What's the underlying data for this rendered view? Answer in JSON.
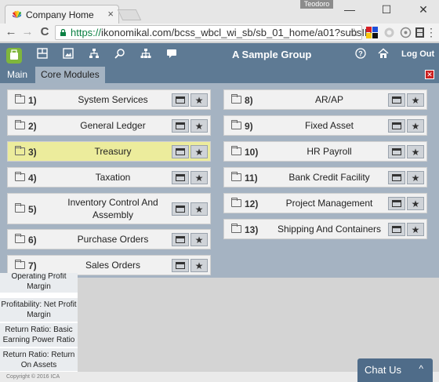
{
  "browser": {
    "tab_title": "Company Home",
    "user_badge": "Teodoro",
    "url_scheme": "https://",
    "url_rest": "ikonomikal.com/bcss_wbcl_wi_sb/sb_01_home/a01?subsID=",
    "window_minimize": "—",
    "window_maximize": "☐",
    "window_close": "✕",
    "back_glyph": "←",
    "forward_glyph": "→",
    "reload_glyph": "C"
  },
  "app": {
    "group_title": "A Sample Group",
    "logout_label": "Log Out"
  },
  "menu": {
    "tabs": [
      "Main",
      "Core Modules"
    ],
    "close_glyph": "✕"
  },
  "modules": {
    "left": [
      {
        "num": "1)",
        "name": "System Services"
      },
      {
        "num": "2)",
        "name": "General Ledger"
      },
      {
        "num": "3)",
        "name": "Treasury",
        "highlighted": true
      },
      {
        "num": "4)",
        "name": "Taxation"
      },
      {
        "num": "5)",
        "name": "Inventory Control And Assembly"
      },
      {
        "num": "6)",
        "name": "Purchase Orders"
      },
      {
        "num": "7)",
        "name": "Sales Orders"
      }
    ],
    "right": [
      {
        "num": "8)",
        "name": "AR/AP"
      },
      {
        "num": "9)",
        "name": "Fixed Asset"
      },
      {
        "num": "10)",
        "name": "HR Payroll"
      },
      {
        "num": "11)",
        "name": "Bank Credit Facility"
      },
      {
        "num": "12)",
        "name": "Project Management"
      },
      {
        "num": "13)",
        "name": "Shipping And Containers"
      }
    ]
  },
  "sidebar": {
    "items": [
      "Operating Profit Margin",
      "Profitability: Net Profit Margin",
      "Return Ratio: Basic Earning Power Ratio",
      "Return Ratio: Return On Assets"
    ]
  },
  "footer": {
    "copyright": "Copyright © 2016 ICA"
  },
  "chat": {
    "label": "Chat Us",
    "chevron": "^"
  },
  "colors": {
    "header": "#5e7a94",
    "panel": "#a5b3c2",
    "highlight": "#ecec9c",
    "logo": "#7fb63c"
  }
}
